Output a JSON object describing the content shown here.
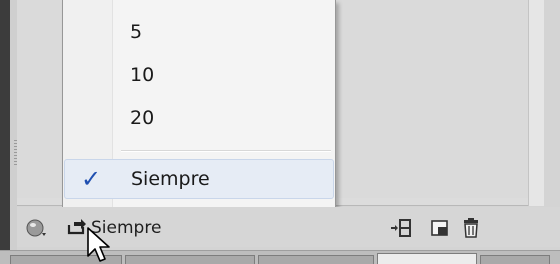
{
  "menu": {
    "items": [
      {
        "label": "5",
        "checked": false
      },
      {
        "label": "10",
        "checked": false
      },
      {
        "label": "20",
        "checked": false
      },
      {
        "label": "Siempre",
        "checked": true
      }
    ]
  },
  "toolbar": {
    "loop_value": "Siempre",
    "icons": [
      "sphere-menu-icon",
      "loop-icon",
      "copy-frames-icon",
      "new-layer-icon",
      "trash-icon"
    ]
  },
  "tabs": {
    "count": 5,
    "active_index": 3
  },
  "colors": {
    "check": "#1f4fb0",
    "selected_bg": "#e6ecf5",
    "window_edge": "#3c3c3c"
  }
}
